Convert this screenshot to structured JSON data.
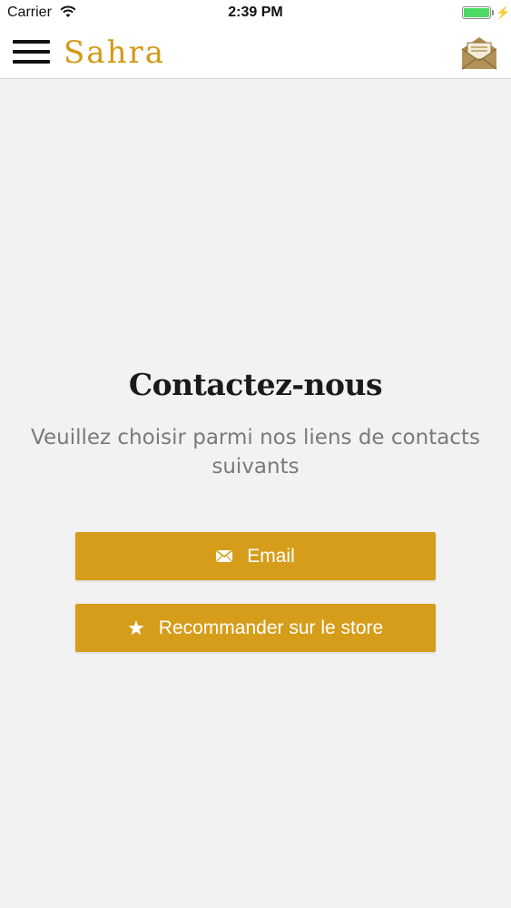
{
  "status_bar": {
    "carrier": "Carrier",
    "time": "2:39 PM"
  },
  "nav": {
    "brand": "Sahra",
    "menu_icon": "hamburger-menu-icon",
    "contact_icon": "envelope-open-icon",
    "accent_color": "#d29a17"
  },
  "contact": {
    "title": "Contactez-nous",
    "subtitle": "Veuillez choisir parmi nos liens de contacts suivants",
    "buttons": [
      {
        "label": "Email",
        "icon": "mail-icon"
      },
      {
        "label": "Recommander sur le store",
        "icon": "star-icon"
      }
    ],
    "button_color": "#d69d1b"
  }
}
